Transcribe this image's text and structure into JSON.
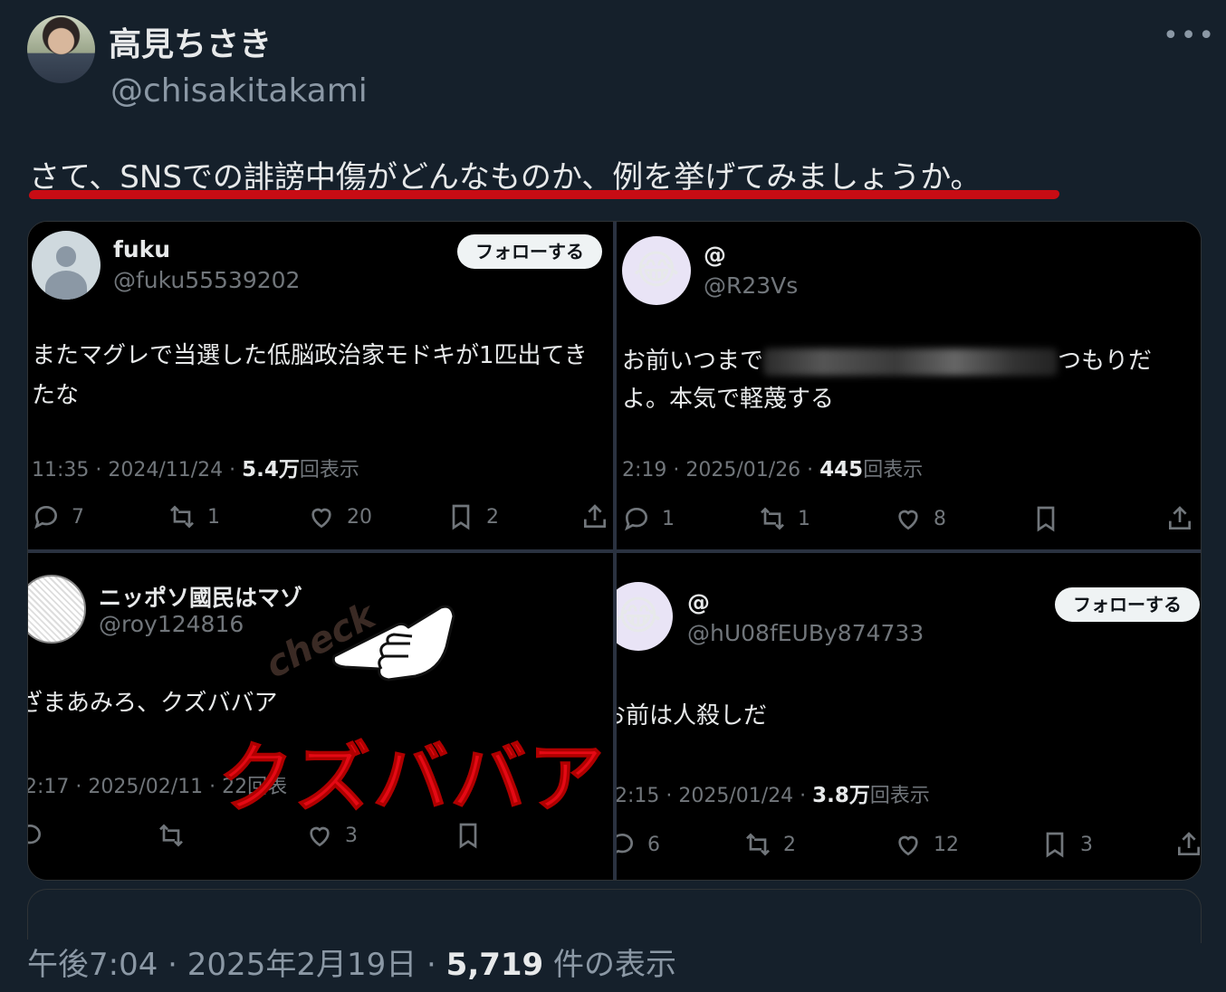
{
  "author": {
    "name": "高見ちさき",
    "handle": "@chisakitakami"
  },
  "tweet": {
    "text": "さて、SNSでの誹謗中傷がどんなものか、例を挙げてみましょうか。"
  },
  "screenshots": [
    {
      "name": "fuku",
      "handle": "@fuku55539202",
      "follow_label": "フォローする",
      "body_line1": "またマグレで当選した低脳政治家モドキが1匹出てき",
      "body_line2": "たな",
      "time_date": "11:35 · 2024/11/24 · ",
      "views": "5.4万",
      "views_suffix": "回表示",
      "replies": "7",
      "reposts": "1",
      "likes": "20",
      "bookmarks": "2"
    },
    {
      "name": "@",
      "handle": "@R23Vs",
      "avatar_emoji": "😂",
      "body_line1_start": "お前いつまで",
      "body_line1_end": "つもりだ",
      "body_line2": "よ。本気で軽蔑する",
      "time_date": "2:19 · 2025/01/26 · ",
      "views": "445",
      "views_suffix": "回表示",
      "replies": "1",
      "reposts": "1",
      "likes": "8"
    },
    {
      "name": "ニッポソ國民はマゾ",
      "handle": "@roy124816",
      "body_line1": "ざまあみろ、クズババア",
      "time_date": "2:17 · 2025/02/11 · 22",
      "views_suffix": "回表",
      "likes": "3"
    },
    {
      "name": "@",
      "handle": "@hU08fEUBy874733",
      "avatar_emoji": "😂",
      "follow_label": "フォローする",
      "body_line1": "お前は人殺しだ",
      "time_date": "2:15 · 2025/01/24 · ",
      "views": "3.8万",
      "views_suffix": "回表示",
      "replies": "6",
      "reposts": "2",
      "likes": "12",
      "bookmarks": "3"
    }
  ],
  "overlay": {
    "check_label": "check",
    "caption": "クズババア"
  },
  "footer": {
    "time": "午後7:04",
    "sep": " · ",
    "date": "2025年2月19日",
    "sep2": " · ",
    "count": "5,719",
    "count_suffix": " 件の表示"
  },
  "colors": {
    "background": "#15202b",
    "underline": "#c80c14",
    "caption": "#e50914"
  }
}
